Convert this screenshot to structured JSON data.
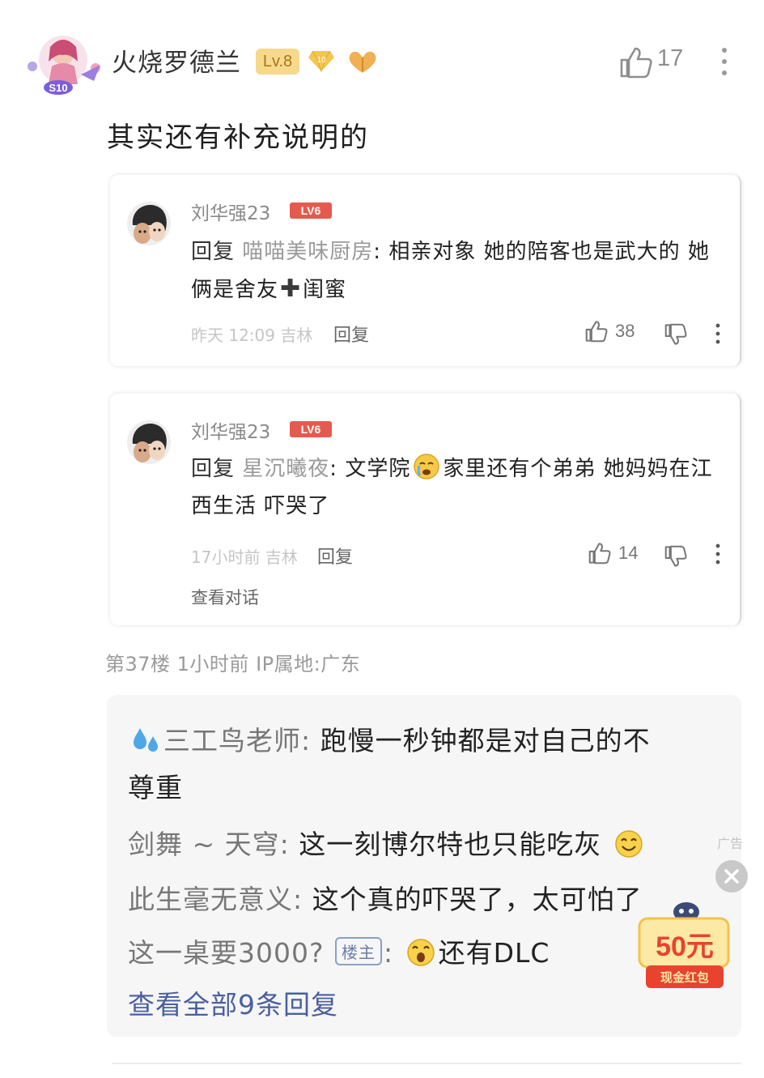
{
  "post": {
    "username": "火烧罗德兰",
    "level": "Lv.8",
    "vip_level": "10",
    "like_count": "17",
    "content": "其实还有补充说明的",
    "avatar_badge": "S10"
  },
  "replies": [
    {
      "name": "刘华强23",
      "level": "LV6",
      "reply_prefix": "回复",
      "reply_target": "喵喵美味厨房",
      "text_part1": ": 相亲对象 她的陪客也是武大的 她俩是舍友",
      "text_part2": "闺蜜",
      "time_location": "昨天 12:09 吉林",
      "reply_label": "回复",
      "likes": "38"
    },
    {
      "name": "刘华强23",
      "level": "LV6",
      "reply_prefix": "回复",
      "reply_target": "星沉曦夜",
      "text_part1": ": 文学院",
      "text_part2": "家里还有个弟弟 她妈妈在江西生活 吓哭了",
      "time_location": "17小时前 吉林",
      "reply_label": "回复",
      "likes": "14",
      "view_conversation": "查看对话"
    }
  ],
  "floor_info": "第37楼  1小时前  IP属地:广东",
  "sub_replies": [
    {
      "author": "三工鸟老师:",
      "text": "跑慢一秒钟都是对自己的不",
      "text_cont": "尊重"
    },
    {
      "author": "剑舞 ~ 天穹:",
      "text": "这一刻博尔特也只能吃灰"
    },
    {
      "author": "此生毫无意义:",
      "text": "这个真的吓哭了，太可怕了"
    },
    {
      "author": "这一桌要3000?",
      "badge": "楼主",
      "text": "还有DLC"
    }
  ],
  "view_all_replies": "查看全部9条回复",
  "ad": {
    "label": "广告",
    "amount": "50元",
    "caption": "现金红包"
  },
  "colors": {
    "link_blue": "#4a5fa0",
    "level_red": "#e55a4f",
    "gold_badge": "#f6d98a",
    "ad_red": "#e8432f",
    "ad_gold": "#f5c24a"
  }
}
